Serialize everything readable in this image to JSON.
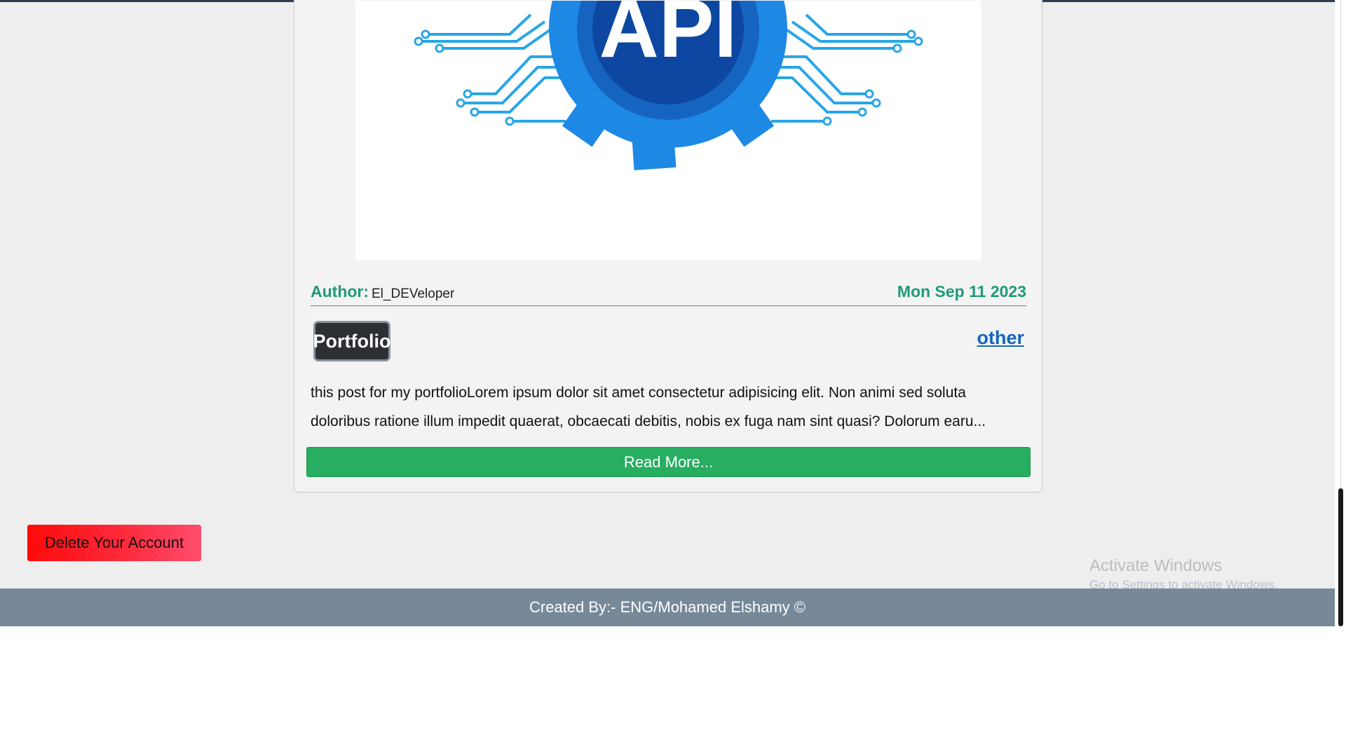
{
  "post": {
    "image_text": "API",
    "author_label": "Author:",
    "author_name": "El_DEVeloper",
    "date": "Mon Sep 11 2023",
    "tag": "Portfolio",
    "category": "other",
    "excerpt": "this post for my portfolioLorem ipsum dolor sit amet consectetur adipisicing elit. Non animi sed soluta doloribus ratione illum impedit quaerat, obcaecati debitis, nobis ex fuga nam sint quasi? Dolorum earu...",
    "read_more_label": "Read More..."
  },
  "account": {
    "delete_label": "Delete Your Account"
  },
  "footer": {
    "text": "Created By:- ENG/Mohamed Elshamy ©"
  },
  "watermark": {
    "title": "Activate Windows",
    "subtitle": "Go to Settings to activate Windows."
  },
  "colors": {
    "accent_green": "#1f9a7a",
    "read_more_bg": "#27ae60",
    "link_blue": "#1565c0",
    "footer_bg": "#778899",
    "delete_bg": "#ff0a0a",
    "api_blue": "#1e88e5"
  },
  "icons": {
    "post_image": "api-gear-circuit-icon"
  }
}
